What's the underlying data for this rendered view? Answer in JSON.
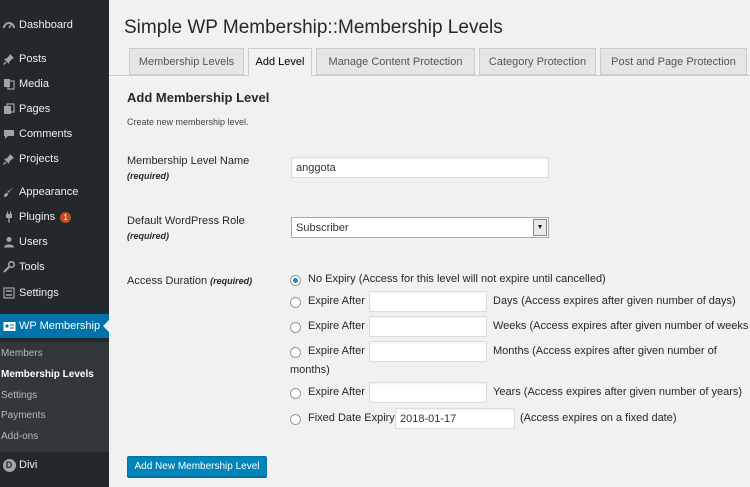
{
  "sidebar": {
    "items": [
      {
        "label": "Dashboard",
        "icon": "dashboard-icon"
      },
      {
        "label": "Posts",
        "icon": "pin-icon"
      },
      {
        "label": "Media",
        "icon": "media-icon"
      },
      {
        "label": "Pages",
        "icon": "pages-icon"
      },
      {
        "label": "Comments",
        "icon": "comments-icon"
      },
      {
        "label": "Projects",
        "icon": "pin-icon"
      },
      {
        "label": "Appearance",
        "icon": "brush-icon"
      },
      {
        "label": "Plugins",
        "icon": "plugin-icon",
        "badge": "1"
      },
      {
        "label": "Users",
        "icon": "users-icon"
      },
      {
        "label": "Tools",
        "icon": "wrench-icon"
      },
      {
        "label": "Settings",
        "icon": "settings-icon"
      },
      {
        "label": "WP Membership",
        "icon": "id-card-icon"
      },
      {
        "label": "Divi",
        "icon": "divi-logo"
      }
    ],
    "submenu": [
      "Members",
      "Membership Levels",
      "Settings",
      "Payments",
      "Add-ons"
    ]
  },
  "page": {
    "title": "Simple WP Membership::Membership Levels",
    "tabs": [
      "Membership Levels",
      "Add Level",
      "Manage Content Protection",
      "Category Protection",
      "Post and Page Protection"
    ],
    "active_tab": "Add Level"
  },
  "form": {
    "heading": "Add Membership Level",
    "description": "Create new membership level.",
    "name_label": "Membership Level Name",
    "name_required": "(required)",
    "name_value": "anggota",
    "role_label": "Default WordPress Role",
    "role_required": "(required)",
    "role_value": "Subscriber",
    "duration_label": "Access Duration",
    "duration_required": "(required)",
    "options": {
      "no_expiry": "No Expiry (Access for this level will not expire until cancelled)",
      "expire_after": "Expire After",
      "days": "Days (Access expires after given number of days)",
      "weeks": "Weeks (Access expires after given number of weeks",
      "months_line1": "Months (Access expires after given number of",
      "months_line2": "months)",
      "years": "Years (Access expires after given number of years)",
      "fixed_label": "Fixed Date Expiry",
      "fixed_value": "2018-01-17",
      "fixed_desc": "(Access expires on a fixed date)"
    },
    "submit_label": "Add New Membership Level"
  },
  "colors": {
    "sidebar_bg": "#23282d",
    "active_menu": "#0073aa",
    "primary_button": "#0085ba"
  }
}
